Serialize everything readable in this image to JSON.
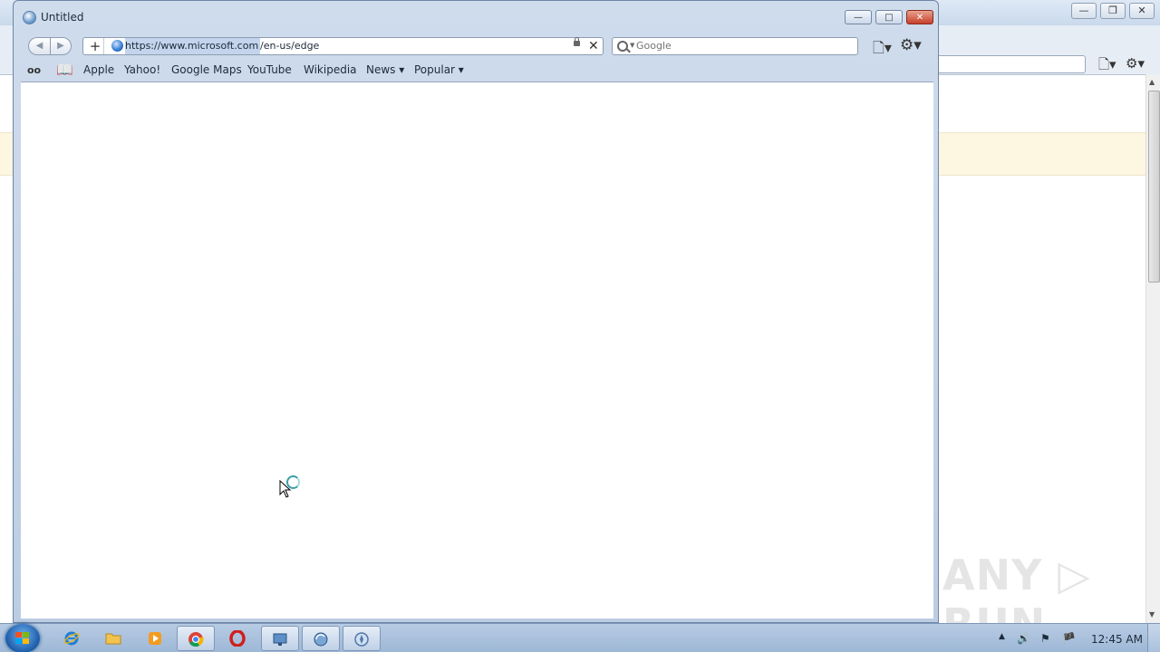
{
  "window": {
    "title": "Untitled",
    "controls": {
      "minimize": "—",
      "maximize": "□",
      "close": "✕"
    }
  },
  "toolbar": {
    "back": "◀",
    "forward": "▶",
    "add": "+",
    "url_selected": "https://www.microsoft.com",
    "url_rest": "/en-us/edge",
    "stop": "✕",
    "search_placeholder": "Google",
    "page_menu": "🗋▾",
    "settings_menu": "⚙▾"
  },
  "bookmarks": {
    "reading_list": "oo",
    "bookmarks_icon": "📖",
    "items": [
      "Apple",
      "Yahoo!",
      "Google Maps",
      "YouTube",
      "Wikipedia",
      "News ▾",
      "Popular ▾"
    ]
  },
  "background_window": {
    "controls": {
      "minimize": "—",
      "restore": "❐",
      "close": "✕"
    },
    "page_menu": "🗋▾",
    "settings_menu": "⚙▾"
  },
  "watermark": "ANY ▷ RUN",
  "taskbar": {
    "items": [
      "internet-explorer",
      "file-explorer",
      "media-player",
      "chrome",
      "opera",
      "remote-desktop",
      "app-updater",
      "safari"
    ],
    "clock": "12:45 AM",
    "tray": [
      "▲",
      "🔊",
      "⚑",
      "🏴"
    ]
  },
  "colors": {
    "title_bar": "#c9d9ec",
    "close_button": "#c7402a",
    "url_highlight": "#c3d4ec",
    "taskbar": "#9db7d6"
  }
}
